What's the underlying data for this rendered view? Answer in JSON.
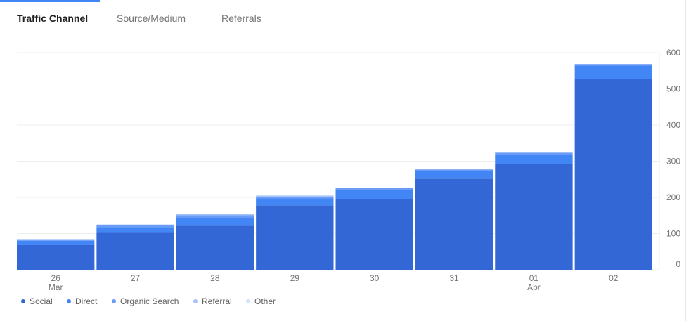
{
  "tabs": [
    {
      "label": "Traffic Channel",
      "active": true
    },
    {
      "label": "Source/Medium",
      "active": false
    },
    {
      "label": "Referrals",
      "active": false
    }
  ],
  "colors": {
    "social": "#3367d6",
    "direct": "#4285f4",
    "organic_search": "#699bf7",
    "referral": "#a1c2fa",
    "other": "#d2e3fc",
    "grid": "#eeeeee",
    "axis_text": "#757575",
    "tab_indicator": "#4285f4"
  },
  "chart_data": {
    "type": "bar",
    "stacked": true,
    "categories": [
      "26",
      "27",
      "28",
      "29",
      "30",
      "31",
      "01",
      "02"
    ],
    "category_sublabels": [
      "Mar",
      "",
      "",
      "",
      "",
      "",
      "Apr",
      ""
    ],
    "series": [
      {
        "name": "Social",
        "values": [
          68,
          102,
          122,
          178,
          196,
          252,
          292,
          528
        ]
      },
      {
        "name": "Direct",
        "values": [
          12,
          16,
          23,
          19,
          25,
          20,
          25,
          36
        ]
      },
      {
        "name": "Organic Search",
        "values": [
          4,
          5,
          6,
          5,
          5,
          5,
          6,
          4
        ]
      },
      {
        "name": "Referral",
        "values": [
          1,
          2,
          3,
          3,
          1,
          2,
          2,
          1
        ]
      },
      {
        "name": "Other",
        "values": [
          0,
          0,
          0,
          0,
          0,
          0,
          0,
          0
        ]
      }
    ],
    "y_ticks": [
      "0",
      "100",
      "200",
      "300",
      "400",
      "500",
      "600"
    ],
    "ylim": [
      0,
      600
    ],
    "y_axis_side": "right",
    "grid": true,
    "legend_position": "bottom-left"
  }
}
